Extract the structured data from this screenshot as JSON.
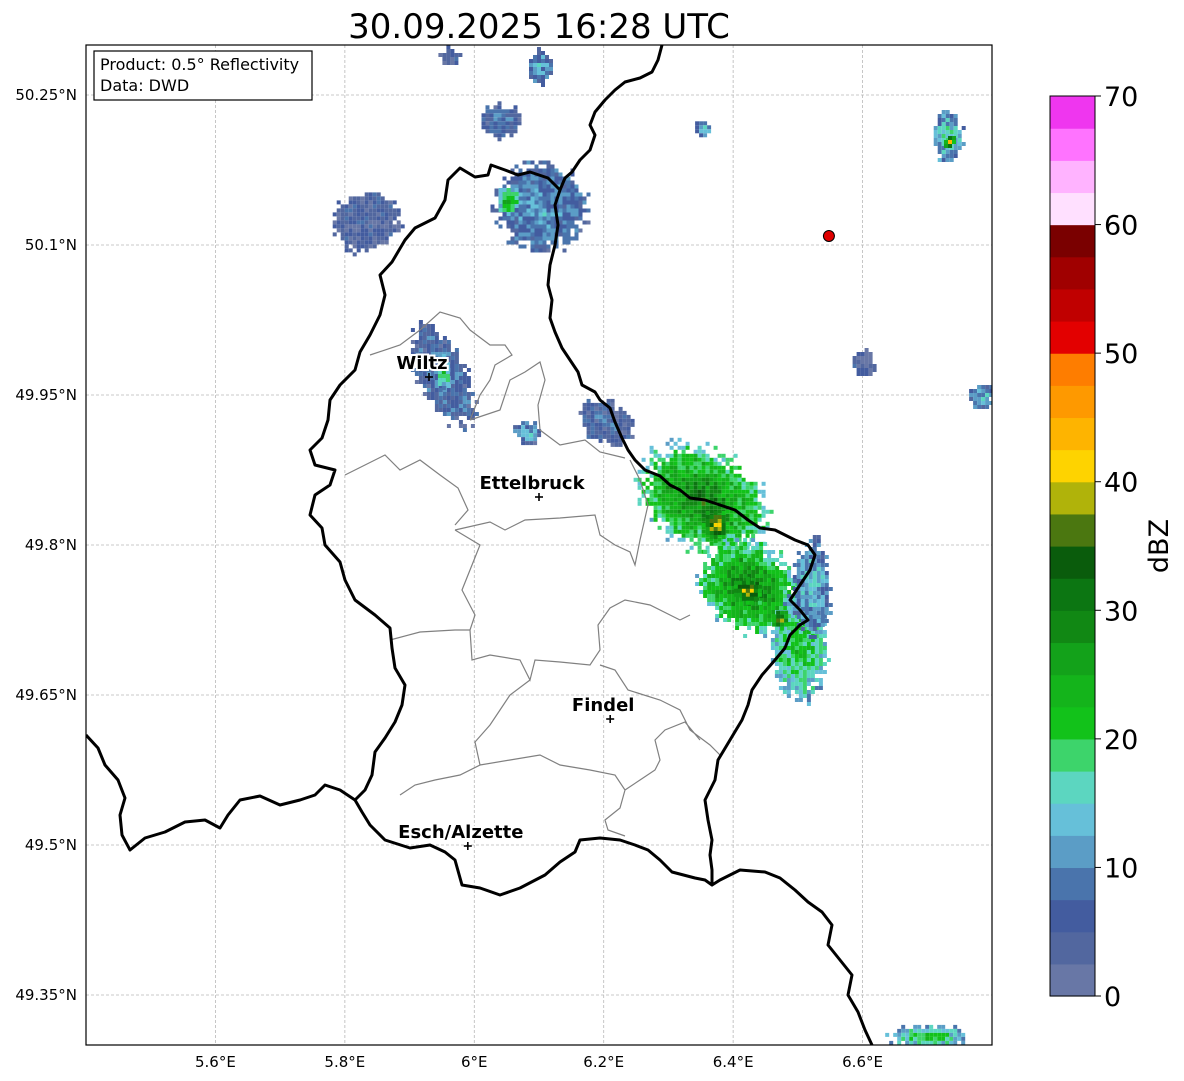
{
  "title": "30.09.2025 16:28 UTC",
  "info_box": {
    "line1": "Product: 0.5° Reflectivity",
    "line2": "Data: DWD"
  },
  "map": {
    "lon_range": [
      5.4,
      6.8
    ],
    "lat_range": [
      49.3,
      50.3
    ],
    "lon_ticks": [
      {
        "value": 5.6,
        "label": "5.6°E"
      },
      {
        "value": 5.8,
        "label": "5.8°E"
      },
      {
        "value": 6.0,
        "label": "6°E"
      },
      {
        "value": 6.2,
        "label": "6.2°E"
      },
      {
        "value": 6.4,
        "label": "6.4°E"
      },
      {
        "value": 6.6,
        "label": "6.6°E"
      }
    ],
    "lat_ticks": [
      {
        "value": 50.25,
        "label": "50.25°N"
      },
      {
        "value": 50.1,
        "label": "50.1°N"
      },
      {
        "value": 49.95,
        "label": "49.95°N"
      },
      {
        "value": 49.8,
        "label": "49.8°N"
      },
      {
        "value": 49.65,
        "label": "49.65°N"
      },
      {
        "value": 49.5,
        "label": "49.5°N"
      },
      {
        "value": 49.35,
        "label": "49.35°N"
      }
    ],
    "grid": true,
    "cities": [
      {
        "name": "Wiltz",
        "lon": 5.93,
        "lat": 49.968
      },
      {
        "name": "Ettelbruck",
        "lon": 6.1,
        "lat": 49.848
      },
      {
        "name": "Findel",
        "lon": 6.21,
        "lat": 49.626
      },
      {
        "name": "Esch/Alzette",
        "lon": 5.99,
        "lat": 49.499
      }
    ],
    "radar_site": {
      "lon": 6.548,
      "lat": 50.109,
      "color": "#e00000"
    },
    "echoes": [
      {
        "lon": 6.35,
        "lat": 49.848,
        "rlon": 0.11,
        "rlat": 0.05,
        "rot": 30,
        "dbz": 32
      },
      {
        "lon": 6.42,
        "lat": 49.76,
        "rlon": 0.085,
        "rlat": 0.045,
        "rot": 35,
        "dbz": 32
      },
      {
        "lon": 6.5,
        "lat": 49.7,
        "rlon": 0.045,
        "rlat": 0.055,
        "rot": 0,
        "dbz": 24
      },
      {
        "lon": 6.52,
        "lat": 49.76,
        "rlon": 0.03,
        "rlat": 0.05,
        "rot": 0,
        "dbz": 15
      },
      {
        "lon": 6.37,
        "lat": 49.822,
        "rlon": 0.022,
        "rlat": 0.016,
        "rot": 30,
        "dbz": 44
      },
      {
        "lon": 6.42,
        "lat": 49.756,
        "rlon": 0.025,
        "rlat": 0.013,
        "rot": 30,
        "dbz": 42
      },
      {
        "lon": 6.47,
        "lat": 49.728,
        "rlon": 0.016,
        "rlat": 0.01,
        "rot": 20,
        "dbz": 40
      },
      {
        "lon": 6.2,
        "lat": 49.925,
        "rlon": 0.045,
        "rlat": 0.022,
        "rot": 30,
        "dbz": 8
      },
      {
        "lon": 5.95,
        "lat": 49.97,
        "rlon": 0.04,
        "rlat": 0.055,
        "rot": -25,
        "dbz": 10
      },
      {
        "lon": 5.95,
        "lat": 49.975,
        "rlon": 0.012,
        "rlat": 0.02,
        "rot": 0,
        "dbz": 22
      },
      {
        "lon": 6.08,
        "lat": 49.915,
        "rlon": 0.02,
        "rlat": 0.012,
        "rot": 0,
        "dbz": 14
      },
      {
        "lon": 5.83,
        "lat": 50.125,
        "rlon": 0.055,
        "rlat": 0.03,
        "rot": -20,
        "dbz": 6
      },
      {
        "lon": 6.1,
        "lat": 50.14,
        "rlon": 0.075,
        "rlat": 0.045,
        "rot": 0,
        "dbz": 12
      },
      {
        "lon": 6.05,
        "lat": 50.145,
        "rlon": 0.018,
        "rlat": 0.016,
        "rot": 0,
        "dbz": 26
      },
      {
        "lon": 6.04,
        "lat": 50.225,
        "rlon": 0.035,
        "rlat": 0.018,
        "rot": 0,
        "dbz": 9
      },
      {
        "lon": 6.1,
        "lat": 50.28,
        "rlon": 0.02,
        "rlat": 0.018,
        "rot": 0,
        "dbz": 12
      },
      {
        "lon": 5.96,
        "lat": 50.29,
        "rlon": 0.015,
        "rlat": 0.01,
        "rot": 0,
        "dbz": 5
      },
      {
        "lon": 6.35,
        "lat": 50.218,
        "rlon": 0.015,
        "rlat": 0.008,
        "rot": 0,
        "dbz": 14
      },
      {
        "lon": 6.73,
        "lat": 50.21,
        "rlon": 0.025,
        "rlat": 0.025,
        "rot": 0,
        "dbz": 18
      },
      {
        "lon": 6.732,
        "lat": 50.205,
        "rlon": 0.008,
        "rlat": 0.008,
        "rot": 0,
        "dbz": 42
      },
      {
        "lon": 6.6,
        "lat": 49.983,
        "rlon": 0.02,
        "rlat": 0.014,
        "rot": 0,
        "dbz": 6
      },
      {
        "lon": 6.78,
        "lat": 49.95,
        "rlon": 0.02,
        "rlat": 0.014,
        "rot": 0,
        "dbz": 14
      },
      {
        "lon": 6.7,
        "lat": 49.31,
        "rlon": 0.065,
        "rlat": 0.012,
        "rot": 0,
        "dbz": 22
      }
    ]
  },
  "colorbar": {
    "label": "dBZ",
    "min": 0,
    "max": 70,
    "ticks": [
      0,
      10,
      20,
      30,
      40,
      50,
      60,
      70
    ],
    "colors": [
      "#6877a6",
      "#52679f",
      "#435c9f",
      "#4a74ac",
      "#5b9dc6",
      "#66c0d9",
      "#5cd6c0",
      "#3dd46b",
      "#12c21a",
      "#14b41b",
      "#13a21a",
      "#118814",
      "#0c7612",
      "#0a5c0c",
      "#4b7710",
      "#b0b30a",
      "#fed300",
      "#feb400",
      "#fe9900",
      "#fe7d00",
      "#e30000",
      "#c00000",
      "#a00000",
      "#7a0000",
      "#ffe0ff",
      "#ffb3ff",
      "#ff73ff",
      "#ef36ef"
    ]
  }
}
